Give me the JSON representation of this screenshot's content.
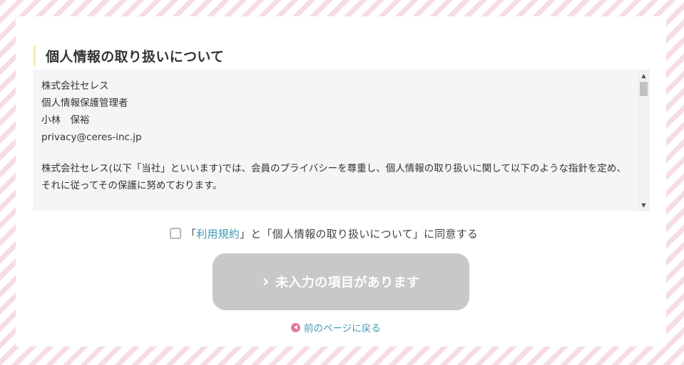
{
  "section": {
    "title": "個人情報の取り扱いについて"
  },
  "privacy_notice": {
    "company": "株式会社セレス",
    "role": "個人情報保護管理者",
    "person": "小林　保裕",
    "email": "privacy@ceres-inc.jp",
    "policy_intro": "株式会社セレス(以下「当社」といいます)では、会員のプライバシーを尊重し、個人情報の取り扱いに関して以下のような指針を定め、それに従ってその保護に努めております。"
  },
  "agreement": {
    "prefix": "「",
    "terms_link": "利用規約",
    "suffix": "」と「個人情報の取り扱いについて」に同意する",
    "checked": false
  },
  "submit": {
    "label": "未入力の項目があります",
    "icon": "chevron-right-icon"
  },
  "back": {
    "label": "前のページに戻る",
    "icon": "back-arrow-icon"
  },
  "colors": {
    "background_stripe": "#f6dde2",
    "heading_accent": "#f3eeb0",
    "link": "#3f9bb2",
    "disabled_button": "#c9c7c8",
    "back_icon": "#e27a98"
  }
}
